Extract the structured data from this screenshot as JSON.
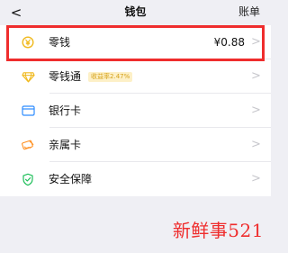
{
  "navbar": {
    "back_icon": "chevron-left-icon",
    "back_glyph": "<",
    "title": "钱包",
    "right_label": "账单"
  },
  "wallet_items": [
    {
      "label": "零钱",
      "value": "¥0.88",
      "icon": "coin-yen-icon",
      "chevron": ">"
    },
    {
      "label": "零钱通",
      "badge": "收益率2.47%",
      "icon": "diamond-icon",
      "chevron": ">"
    },
    {
      "label": "银行卡",
      "icon": "card-icon",
      "chevron": ">"
    },
    {
      "label": "亲属卡",
      "icon": "family-card-icon",
      "chevron": ">"
    },
    {
      "label": "安全保障",
      "icon": "shield-check-icon",
      "chevron": ">"
    }
  ],
  "watermark": {
    "text": "新鲜事521"
  },
  "colors": {
    "highlight_border": "#ef2d2d",
    "gold": "#f0b91d",
    "blue": "#2d8cff",
    "orange": "#ff8f1f",
    "green": "#1fbf5a"
  }
}
